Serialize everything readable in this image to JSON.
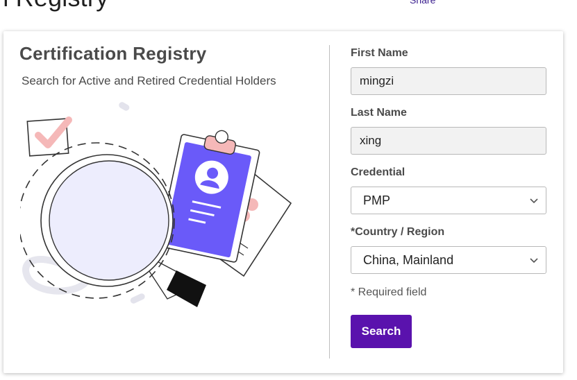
{
  "page": {
    "heading": "on Registry",
    "share_label": "Share"
  },
  "card": {
    "title": "Certification Registry",
    "subtitle": "Search for Active and Retired Credential Holders"
  },
  "form": {
    "first_name": {
      "label": "First Name",
      "value": "mingzi"
    },
    "last_name": {
      "label": "Last Name",
      "value": "xing"
    },
    "credential": {
      "label": "Credential",
      "selected": "PMP"
    },
    "country": {
      "label": "*Country / Region",
      "selected": "China, Mainland"
    },
    "required_note": "* Required field",
    "search_label": "Search"
  },
  "colors": {
    "accent": "#5a12ad",
    "illustration_blue": "#6a5af9",
    "illustration_pink": "#f5b8b8",
    "lens_fill": "#ededfd"
  },
  "icons": [
    "chevron-down-icon",
    "checkmark-icon",
    "magnifier-icon",
    "clipboard-icon",
    "user-icon"
  ]
}
